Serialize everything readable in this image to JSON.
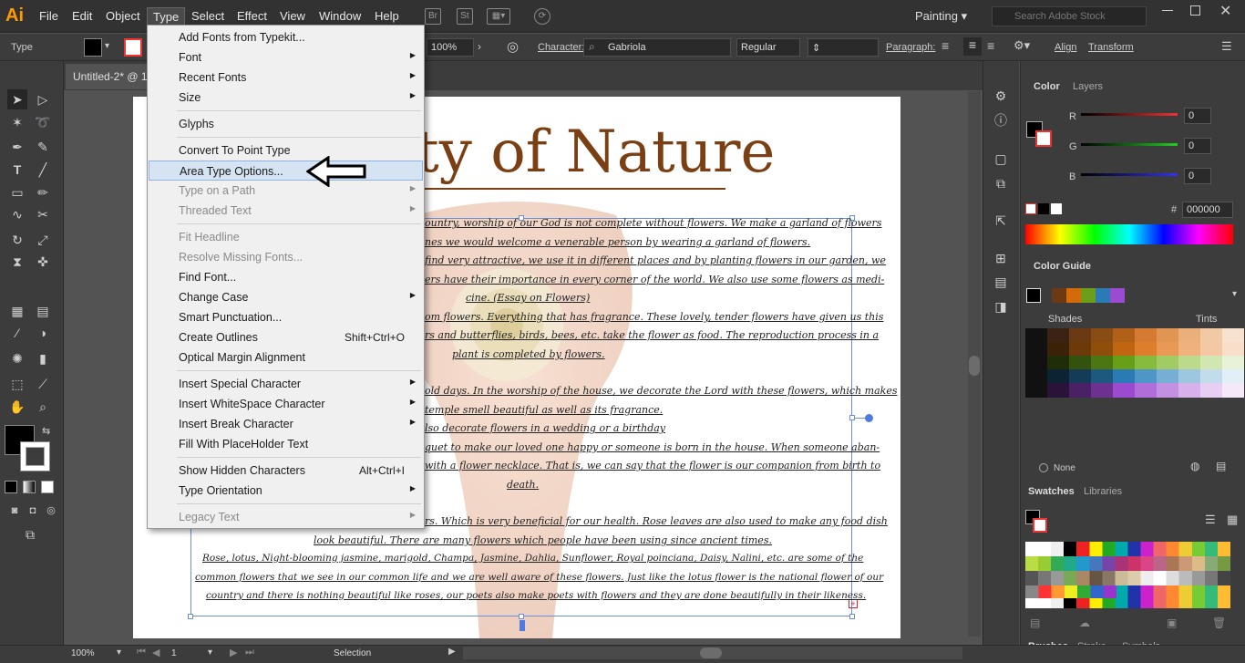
{
  "app": {
    "logo": "Ai",
    "workspace": "Painting",
    "stock_search_placeholder": "Search Adobe Stock"
  },
  "menubar": {
    "items": [
      "File",
      "Edit",
      "Object",
      "Type",
      "Select",
      "Effect",
      "View",
      "Window",
      "Help"
    ]
  },
  "controlbar": {
    "label": "Type",
    "zoom": "100%",
    "character_label": "Character:",
    "font": "Gabriola",
    "style": "Regular",
    "paragraph_label": "Paragraph:",
    "align_label": "Align",
    "transform_label": "Transform"
  },
  "document": {
    "tab_title": "Untitled-2* @ 1"
  },
  "artwork": {
    "title": "ty of Nature",
    "lines": [
      "ountry, worship of our God is not complete without flowers. We make a garland of flowers",
      "nes we would welcome a venerable person by wearing a garland of flowers.",
      "find very attractive, we use it in different places and by planting flowers in our garden, we",
      "ers have their importance in every corner of the world. We also use some flowers as medi-",
      "cine. (Essay on Flowers)",
      "om flowers. Everything that has fragrance. These lovely, tender flowers have given us this",
      "rs and butterflies, birds, bees, etc. take the flower as food. The reproduction process in a",
      "plant is completed by flowers.",
      "old days. In the worship of the house, we decorate the Lord with these flowers, which makes",
      "temple smell beautiful as well as its fragrance.",
      "lso decorate flowers in a wedding or a birthday",
      "quet to make our loved one happy or someone is born in the house. When someone aban-",
      "with a flower necklace. That is, we can say that the flower is our companion from birth to",
      "death.",
      "rs. Which is very beneficial for our health. Rose leaves are also used to make any food dish",
      "look beautiful. There are many flowers which people have been using since ancient times.",
      "Rose, lotus, Night-blooming jasmine, marigold, Champa, Jasmine, Dahlia, Sunflower, Royal poinciana, Daisy, Nalini, etc. are some of the",
      "common flowers that we see in our common life and we are well aware of these flowers. Just like the lotus flower is the national flower of our",
      "country and there is nothing beautiful like roses, our poets also make poets with flowers and they are done beautifully in their likeness."
    ]
  },
  "type_menu": {
    "items": [
      {
        "label": "Add Fonts from Typekit...",
        "arrow": false,
        "disabled": false,
        "shortcut": ""
      },
      {
        "label": "Font",
        "arrow": true,
        "disabled": false,
        "shortcut": ""
      },
      {
        "label": "Recent Fonts",
        "arrow": true,
        "disabled": false,
        "shortcut": ""
      },
      {
        "label": "Size",
        "arrow": true,
        "disabled": false,
        "shortcut": ""
      },
      {
        "label": "Glyphs",
        "arrow": false,
        "disabled": false,
        "shortcut": ""
      },
      {
        "label": "Convert To Point Type",
        "arrow": false,
        "disabled": false,
        "shortcut": ""
      },
      {
        "label": "Area Type Options...",
        "arrow": false,
        "disabled": false,
        "shortcut": ""
      },
      {
        "label": "Type on a Path",
        "arrow": true,
        "disabled": true,
        "shortcut": ""
      },
      {
        "label": "Threaded Text",
        "arrow": true,
        "disabled": true,
        "shortcut": ""
      },
      {
        "label": "Fit Headline",
        "arrow": false,
        "disabled": true,
        "shortcut": ""
      },
      {
        "label": "Resolve Missing Fonts...",
        "arrow": false,
        "disabled": true,
        "shortcut": ""
      },
      {
        "label": "Find Font...",
        "arrow": false,
        "disabled": false,
        "shortcut": ""
      },
      {
        "label": "Change Case",
        "arrow": true,
        "disabled": false,
        "shortcut": ""
      },
      {
        "label": "Smart Punctuation...",
        "arrow": false,
        "disabled": false,
        "shortcut": ""
      },
      {
        "label": "Create Outlines",
        "arrow": false,
        "disabled": false,
        "shortcut": "Shift+Ctrl+O"
      },
      {
        "label": "Optical Margin Alignment",
        "arrow": false,
        "disabled": false,
        "shortcut": ""
      },
      {
        "label": "Insert Special Character",
        "arrow": true,
        "disabled": false,
        "shortcut": ""
      },
      {
        "label": "Insert WhiteSpace Character",
        "arrow": true,
        "disabled": false,
        "shortcut": ""
      },
      {
        "label": "Insert Break Character",
        "arrow": true,
        "disabled": false,
        "shortcut": ""
      },
      {
        "label": "Fill With PlaceHolder Text",
        "arrow": false,
        "disabled": false,
        "shortcut": ""
      },
      {
        "label": "Show Hidden Characters",
        "arrow": false,
        "disabled": false,
        "shortcut": "Alt+Ctrl+I"
      },
      {
        "label": "Type Orientation",
        "arrow": true,
        "disabled": false,
        "shortcut": ""
      },
      {
        "label": "Legacy Text",
        "arrow": true,
        "disabled": true,
        "shortcut": ""
      }
    ],
    "highlighted": "Area Type Options..."
  },
  "color_panel": {
    "tab": "Color",
    "tab2": "Layers",
    "r_label": "R",
    "g_label": "G",
    "b_label": "B",
    "r": "0",
    "g": "0",
    "b": "0",
    "hex": "000000",
    "hash": "#"
  },
  "color_guide": {
    "tab": "Color Guide",
    "shades": "Shades",
    "tints": "Tints",
    "none_label": "None"
  },
  "swatches": {
    "tab": "Swatches",
    "tab2": "Libraries"
  },
  "brushes": {
    "tab": "Brushes",
    "tab2": "Stroke",
    "tab3": "Symbols"
  },
  "statusbar": {
    "zoom": "100%",
    "artboard": "1",
    "tool": "Selection"
  }
}
